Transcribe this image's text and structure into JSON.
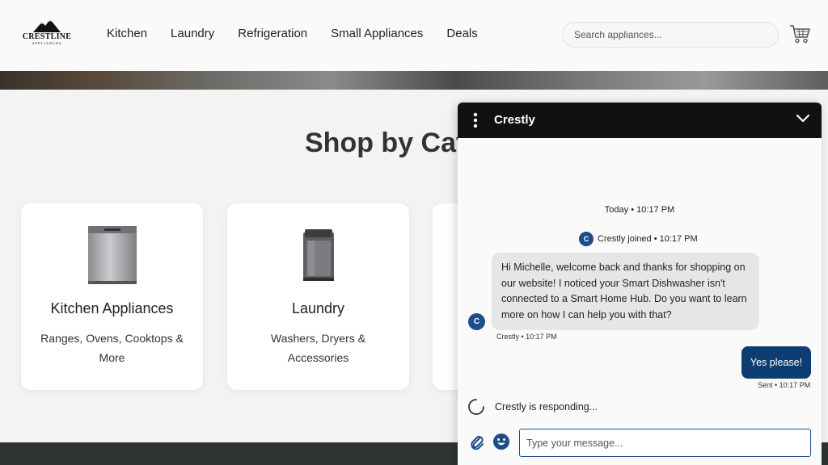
{
  "header": {
    "logo_main": "CRESTLINE",
    "logo_sub": "APPLIANCES",
    "nav": [
      "Kitchen",
      "Laundry",
      "Refrigeration",
      "Small Appliances",
      "Deals"
    ],
    "search_placeholder": "Search appliances...",
    "cart_icon": "shopping-cart-icon"
  },
  "section": {
    "title": "Shop by Cat",
    "cards": [
      {
        "title": "Kitchen Appliances",
        "desc": "Ranges, Ovens, Cooktops & More",
        "icon": "dishwasher-image"
      },
      {
        "title": "Laundry",
        "desc": "Washers, Dryers & Accessories",
        "icon": "washer-image"
      }
    ]
  },
  "chat": {
    "title": "Crestly",
    "date_line": "Today • 10:17 PM",
    "avatar_letter": "C",
    "joined_text": "Crestly joined • 10:17 PM",
    "bot_message": "Hi Michelle, welcome back and thanks for shopping on our website! I noticed your Smart Dishwasher isn't connected to a Smart Home Hub. Do you want to learn more on how I can help you with that?",
    "bot_meta": "Crestly • 10:17 PM",
    "user_message": "Yes please!",
    "user_meta": "Sent • 10:17 PM",
    "typing_text": "Crestly is responding...",
    "input_placeholder": "Type your message...",
    "colors": {
      "accent": "#0d3e73",
      "avatar": "#1d4d8a",
      "header": "#111111"
    }
  }
}
